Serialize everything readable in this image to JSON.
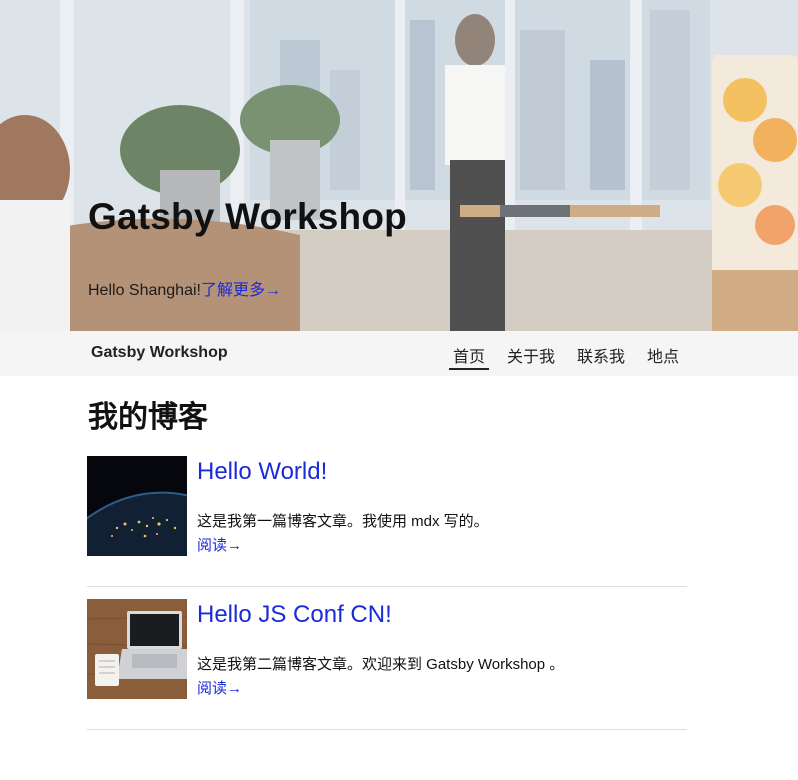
{
  "hero": {
    "title": "Gatsby Workshop",
    "greeting": "Hello Shanghai!",
    "learn_more": "了解更多→"
  },
  "navbar": {
    "brand": "Gatsby Workshop",
    "items": [
      {
        "label": "首页",
        "active": true
      },
      {
        "label": "关于我",
        "active": false
      },
      {
        "label": "联系我",
        "active": false
      },
      {
        "label": "地点",
        "active": false
      }
    ]
  },
  "blog": {
    "heading": "我的博客",
    "posts": [
      {
        "title": "Hello World!",
        "excerpt": "这是我第一篇博客文章。我使用 mdx 写的。",
        "read_label": "阅读→",
        "thumbnail_icon": "earth-at-night-image"
      },
      {
        "title": "Hello JS Conf CN!",
        "excerpt": "这是我第二篇博客文章。欢迎来到 Gatsby Workshop 。",
        "read_label": "阅读→",
        "thumbnail_icon": "laptop-on-desk-image"
      }
    ]
  },
  "colors": {
    "link": "#1a2bd8",
    "navbar_bg": "#f5f5f5",
    "text": "#111111"
  }
}
